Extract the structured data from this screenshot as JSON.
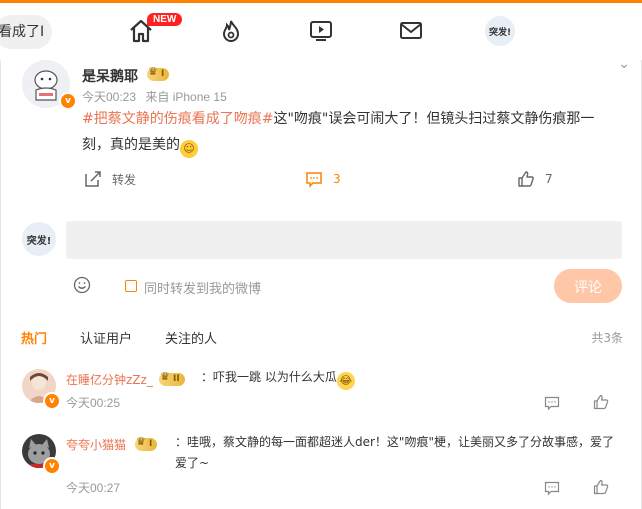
{
  "topbar": {
    "search_text": "看成了I",
    "new_badge": "NEW",
    "avatar_text": "突发!"
  },
  "post": {
    "author": "是呆鹅耶",
    "vip_level": "I",
    "time": "今天00:23",
    "source": "来自 iPhone 15",
    "hashtag": "#把蔡文静的伤痕看成了吻痕#",
    "text": "这\"吻痕\"误会可闹大了！但镜头扫过蔡文静伤痕那一刻，真的是美的",
    "actions": {
      "repost_label": "转发",
      "comment_count": "3",
      "like_count": "7"
    }
  },
  "composer": {
    "avatar_text": "突发!",
    "input_value": "",
    "forward_label": "同时转发到我的微博",
    "submit_label": "评论"
  },
  "comment_tabs": [
    {
      "label": "热门",
      "active": true
    },
    {
      "label": "认证用户",
      "active": false
    },
    {
      "label": "关注的人",
      "active": false
    }
  ],
  "comment_total": "共3条",
  "comments": [
    {
      "user": "在睡亿分钟zZz_",
      "vip_level": "II",
      "text": "：吓我一跳 以为什么大瓜",
      "time": "今天00:25"
    },
    {
      "user": "夸夸小猫猫",
      "vip_level": "I",
      "text": "：哇哦，蔡文静的每一面都超迷人der！这\"吻痕\"梗，让美丽又多了分故事感，爱了爱了~",
      "time": "今天00:27"
    }
  ],
  "colors": {
    "accent": "#ff8200",
    "link": "#eb7350",
    "submit_disabled": "#ffc7a8"
  }
}
